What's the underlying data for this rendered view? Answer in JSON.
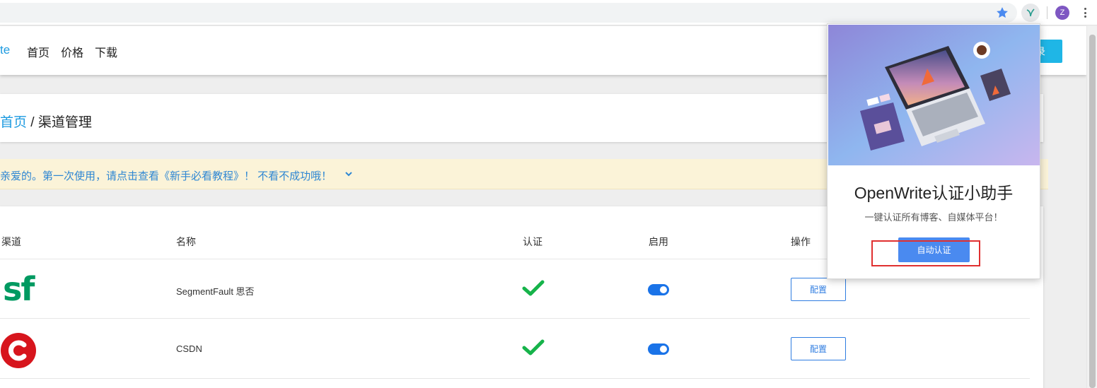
{
  "browser": {
    "avatar_initial": "Z",
    "star_icon": "star-icon",
    "extension_icon": "openwrite-extension-icon",
    "menu_icon": "vertical-dots-icon"
  },
  "header": {
    "brand": "te",
    "nav": [
      "首页",
      "价格",
      "下载"
    ],
    "login_label": "录",
    "accent_color": "#1fb6e6"
  },
  "breadcrumb": {
    "home": "首页",
    "separator": " / ",
    "current": "渠道管理"
  },
  "notice": {
    "text": "亲爱的。第一次使用，请点击查看《新手必看教程》！ 不看不成功哦！"
  },
  "table": {
    "columns": [
      "渠道",
      "名称",
      "认证",
      "启用",
      "操作"
    ],
    "rows": [
      {
        "logo": "sf",
        "name": "SegmentFault 思否",
        "verified": true,
        "enabled": true,
        "action": "配置"
      },
      {
        "logo": "csdn-logo",
        "name": "CSDN",
        "verified": true,
        "enabled": true,
        "action": "配置"
      }
    ]
  },
  "popup": {
    "title": "OpenWrite认证小助手",
    "subtitle": "一键认证所有博客、自媒体平台！",
    "button": "自动认证",
    "highlight_color": "#e03030"
  }
}
